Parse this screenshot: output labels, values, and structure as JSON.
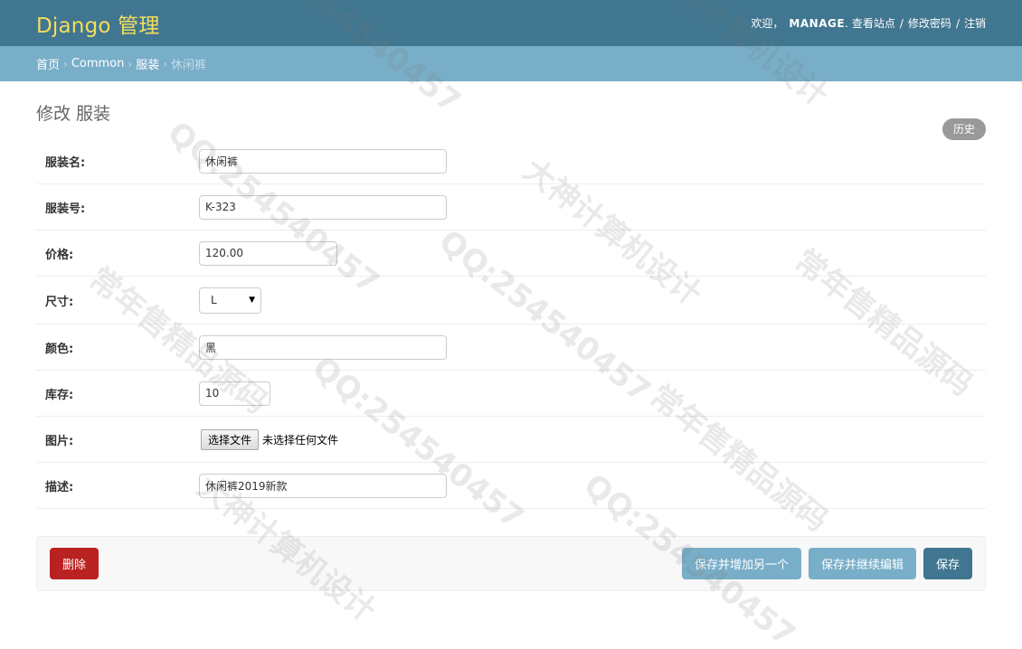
{
  "header": {
    "branding": "Django 管理",
    "welcome": "欢迎，",
    "username": "MANAGE",
    "view_site": "查看站点",
    "change_password": "修改密码",
    "logout": "注销"
  },
  "breadcrumbs": {
    "home": "首页",
    "app": "Common",
    "model": "服装",
    "current": "休闲裤"
  },
  "page": {
    "title": "修改 服装",
    "history": "历史"
  },
  "form": {
    "name": {
      "label": "服装名:",
      "value": "休闲裤"
    },
    "code": {
      "label": "服装号:",
      "value": "K-323"
    },
    "price": {
      "label": "价格:",
      "value": "120.00"
    },
    "size": {
      "label": "尺寸:",
      "value": "L"
    },
    "color": {
      "label": "颜色:",
      "value": "黑"
    },
    "stock": {
      "label": "库存:",
      "value": "10"
    },
    "image": {
      "label": "图片:",
      "button": "选择文件",
      "status": "未选择任何文件"
    },
    "desc": {
      "label": "描述:",
      "value": "休闲裤2019新款"
    }
  },
  "actions": {
    "delete": "删除",
    "save_add": "保存并增加另一个",
    "save_continue": "保存并继续编辑",
    "save": "保存"
  },
  "watermark": {
    "line1": "QQ:254540457",
    "line2": "常年售精品源码",
    "line3": "大神计算机设计"
  }
}
